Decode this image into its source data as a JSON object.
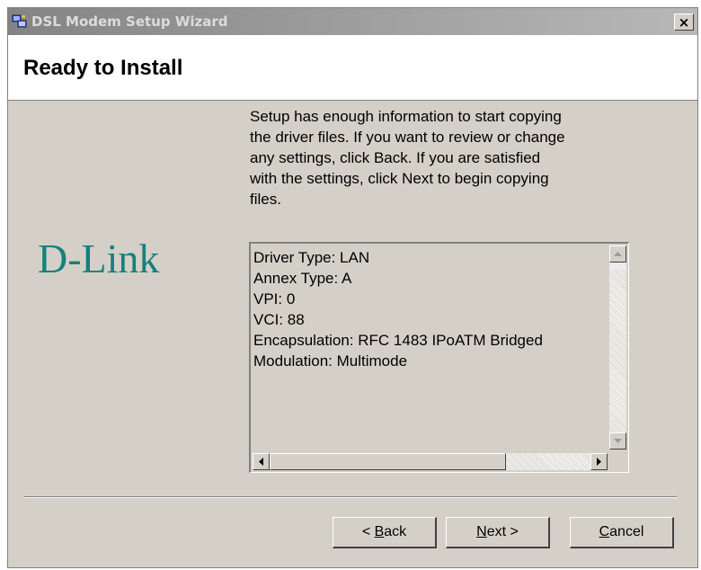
{
  "window": {
    "title": "DSL Modem Setup Wizard",
    "close_glyph": "×"
  },
  "header": {
    "title": "Ready to Install"
  },
  "description": {
    "lines": [
      "Setup has enough information to start copying",
      "the driver files.  If you want to review or change",
      "any settings, click Back.  If you are satisfied",
      "with the settings, click Next to begin copying",
      "files."
    ]
  },
  "logo": {
    "text": "D-Link",
    "color": "#17807c"
  },
  "summary": {
    "lines": [
      "Driver Type: LAN",
      "Annex Type: A",
      "VPI: 0",
      "VCI: 88",
      "Encapsulation: RFC 1483 IPoATM Bridged",
      "Modulation: Multimode"
    ]
  },
  "buttons": {
    "back": {
      "pre": "< ",
      "accel": "B",
      "post": "ack"
    },
    "next": {
      "pre": "",
      "accel": "N",
      "post": "ext >"
    },
    "cancel": {
      "pre": "",
      "accel": "C",
      "post": "ancel"
    }
  },
  "icons": {
    "app": "computer-network-icon",
    "close": "close-icon",
    "scroll_up": "arrow-up-icon",
    "scroll_down": "arrow-down-icon",
    "scroll_left": "arrow-left-icon",
    "scroll_right": "arrow-right-icon"
  }
}
